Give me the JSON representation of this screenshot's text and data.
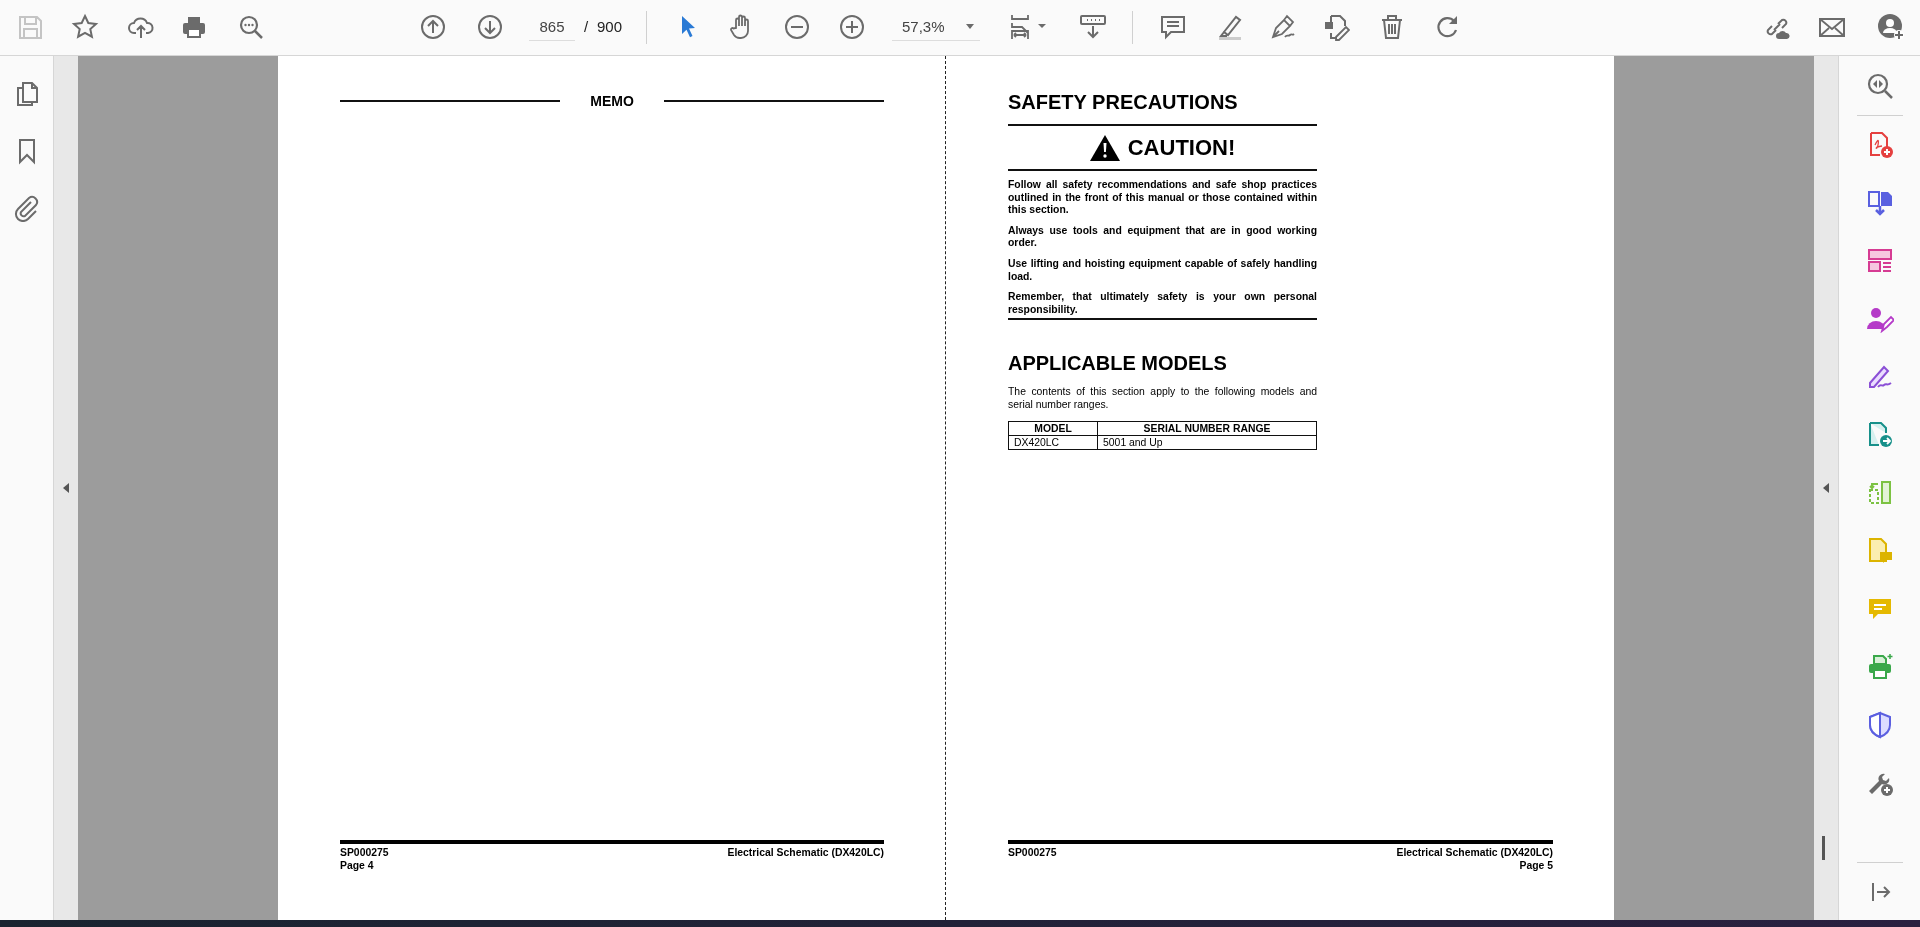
{
  "toolbar": {
    "page_current": "865",
    "page_separator": "/",
    "page_total": "900",
    "zoom": "57,3%"
  },
  "left_page": {
    "header": "MEMO",
    "footer": {
      "doc_id": "SP000275",
      "page": "Page 4",
      "title": "Electrical Schematic (DX420LC)"
    }
  },
  "right_page": {
    "heading": "SAFETY PRECAUTIONS",
    "caution": "CAUTION!",
    "paragraphs": [
      "Follow all safety recommendations and safe shop practices outlined in the front of this manual or those contained within this section.",
      "Always use tools and equipment that are in good working order.",
      "Use lifting and hoisting equipment capable of safely handling load.",
      "Remember, that ultimately safety is your own personal responsibility."
    ],
    "models_heading": "APPLICABLE MODELS",
    "models_intro": "The contents of this section apply to the following models and serial number ranges.",
    "table": {
      "columns": [
        "MODEL",
        "SERIAL NUMBER RANGE"
      ],
      "rows": [
        [
          "DX420LC",
          "5001 and Up"
        ]
      ]
    },
    "footer": {
      "doc_id": "SP000275",
      "page": "Page 5",
      "title": "Electrical Schematic (DX420LC)"
    }
  }
}
